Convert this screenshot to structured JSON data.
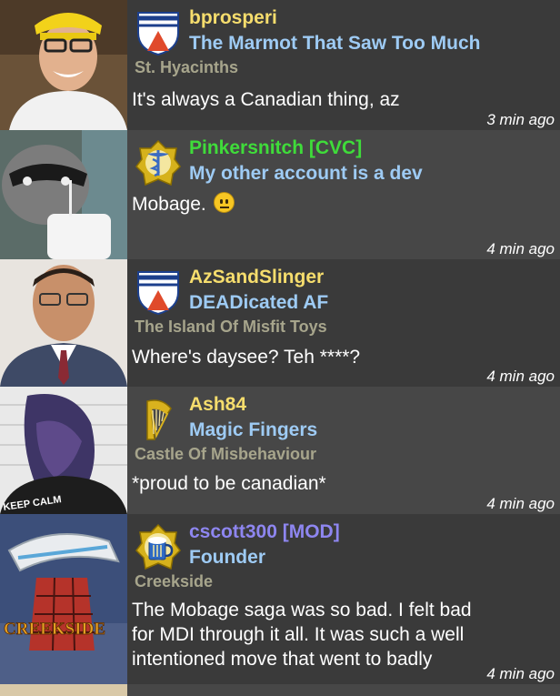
{
  "posts": [
    {
      "username": "bprosperi",
      "title": "The Marmot That Saw Too Much",
      "club": "St. Hyacinths",
      "message": "It's always a Canadian thing, az",
      "time": "3 min ago",
      "badge_icon": "shield-badge-icon"
    },
    {
      "username": "Pinkersnitch  [CVC]",
      "title": "My other account is a dev",
      "club": "",
      "message": "Mobage.",
      "emoji": "neutral-face-emoji",
      "time": "4 min ago",
      "badge_icon": "caduceus-badge-icon"
    },
    {
      "username": "AzSandSlinger",
      "title": "DEADicated AF",
      "club": "The Island Of Misfit Toys",
      "message": "Where's daysee? Teh ****?",
      "time": "4 min ago",
      "badge_icon": "shield-badge-icon"
    },
    {
      "username": "Ash84",
      "title": "Magic Fingers",
      "club": "Castle Of Misbehaviour",
      "message": "*proud to be canadian*",
      "time": "4 min ago",
      "badge_icon": "harp-badge-icon"
    },
    {
      "username": "cscott300 [MOD]",
      "title": "Founder",
      "club": "Creekside",
      "message_lines": [
        "The Mobage saga was so bad. I felt bad",
        "for MDI through it all. It was such a well",
        "intentioned move that went to badly"
      ],
      "time": "4 min ago",
      "badge_icon": "beer-mug-badge-icon",
      "avatar_text": "CREEKSIDE"
    }
  ],
  "avatar_watermark_text": "KEEP CALM",
  "colors": {
    "username_default": "#f6dd6d",
    "username_cvc": "#3fdc3a",
    "username_mod": "#8e86f0",
    "title": "#9ecbf4",
    "club": "#a7a58c"
  }
}
